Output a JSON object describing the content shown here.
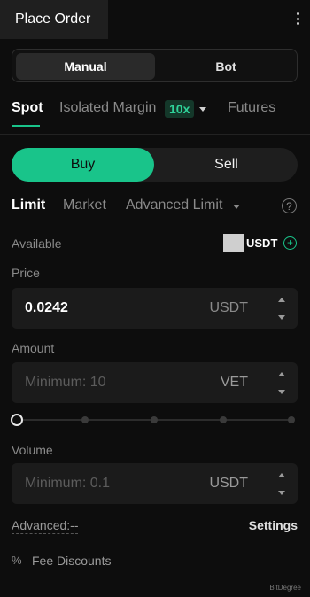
{
  "header": {
    "title": "Place Order",
    "menu_icon": "kebab-menu-icon"
  },
  "mode_tabs": {
    "manual": "Manual",
    "bot": "Bot",
    "selected": "Manual"
  },
  "market_tabs": {
    "spot": "Spot",
    "isolated_margin": "Isolated Margin",
    "leverage": "10x",
    "futures": "Futures",
    "selected": "Spot"
  },
  "side": {
    "buy": "Buy",
    "sell": "Sell",
    "selected": "Buy"
  },
  "order_types": {
    "limit": "Limit",
    "market": "Market",
    "advanced_limit": "Advanced Limit",
    "selected": "Limit"
  },
  "available": {
    "label": "Available",
    "unit": "USDT"
  },
  "price": {
    "label": "Price",
    "value": "0.0242",
    "unit": "USDT"
  },
  "amount": {
    "label": "Amount",
    "placeholder": "Minimum: 10",
    "unit": "VET"
  },
  "slider": {
    "value_percent": 0,
    "ticks": 5
  },
  "volume": {
    "label": "Volume",
    "placeholder": "Minimum: 0.1",
    "unit": "USDT"
  },
  "advanced": {
    "label": "Advanced:--",
    "settings": "Settings"
  },
  "fee": {
    "icon": "%",
    "label": "Fee Discounts"
  },
  "watermark": "BitDegree",
  "colors": {
    "accent": "#19c48a",
    "background": "#0d0d0d"
  }
}
